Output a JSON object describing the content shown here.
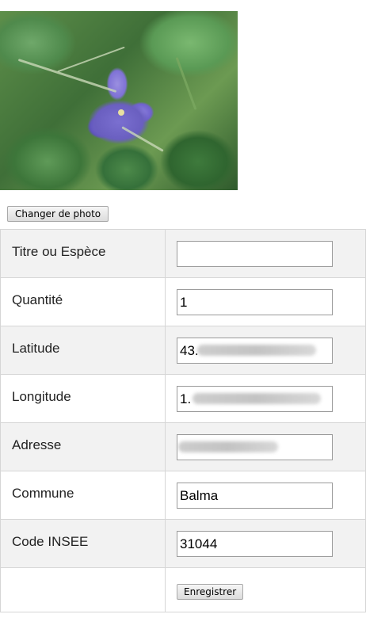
{
  "photo": {
    "change_label": "Changer de photo"
  },
  "form": {
    "rows": [
      {
        "label": "Titre ou Espèce",
        "value": ""
      },
      {
        "label": "Quantité",
        "value": "1"
      },
      {
        "label": "Latitude",
        "value": "43."
      },
      {
        "label": "Longitude",
        "value": "1."
      },
      {
        "label": "Adresse",
        "value": ""
      },
      {
        "label": "Commune",
        "value": "Balma"
      },
      {
        "label": "Code INSEE",
        "value": "31044"
      }
    ],
    "save_label": "Enregistrer"
  }
}
